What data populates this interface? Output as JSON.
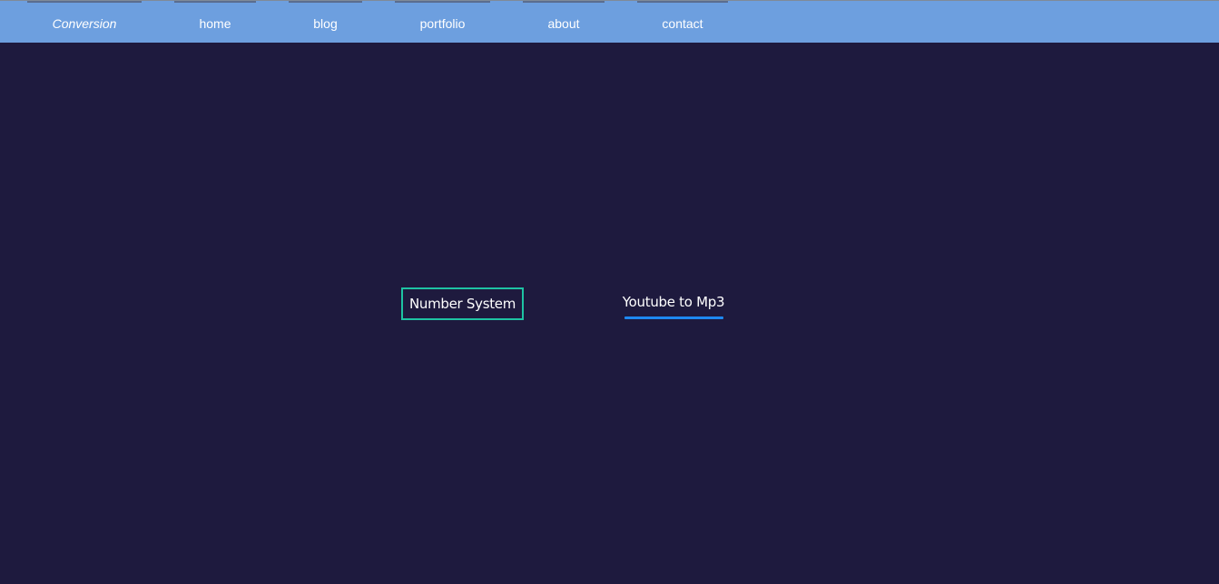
{
  "nav": {
    "brand": "Conversion",
    "items": [
      {
        "label": "home"
      },
      {
        "label": "blog"
      },
      {
        "label": "portfolio"
      },
      {
        "label": "about"
      },
      {
        "label": "contact"
      }
    ]
  },
  "main": {
    "options": [
      {
        "label": "Number System",
        "state": "bordered"
      },
      {
        "label": "Youtube to Mp3",
        "state": "underlined"
      }
    ]
  },
  "colors": {
    "background": "#1e1a3e",
    "navbar": "#6d9fdf",
    "border_accent": "#1ec3a3",
    "underline_accent": "#1e88f0"
  }
}
